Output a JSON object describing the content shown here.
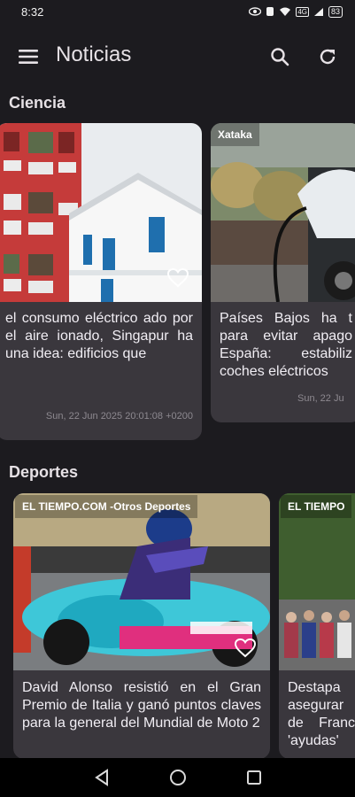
{
  "status": {
    "time": "8:32",
    "network": "4G",
    "battery": "83"
  },
  "app": {
    "title": "Noticias"
  },
  "sections": {
    "science": {
      "title": "Ciencia",
      "cards": [
        {
          "headline": "el consumo eléctrico ado por el aire ionado, Singapur ha una idea: edificios que",
          "date": "Sun, 22 Jun 2025 20:01:08 +0200"
        },
        {
          "source": "Xataka",
          "headline": "Países Bajos ha t para evitar apago España: estabiliz coches eléctricos",
          "date": "Sun, 22 Ju"
        }
      ]
    },
    "sports": {
      "title": "Deportes",
      "cards": [
        {
          "source": "EL TIEMPO.COM -Otros Deportes",
          "headline": "David Alonso resistió en el Gran Premio de Italia y ganó puntos claves para la general del Mundial de Moto 2"
        },
        {
          "source": "EL TIEMPO",
          "headline": "Destapa asegurar de Franc 'ayudas'"
        }
      ]
    }
  },
  "colors": {
    "background": "#1c1b1f",
    "card": "#3a373d",
    "text": "#e6e1e5"
  }
}
